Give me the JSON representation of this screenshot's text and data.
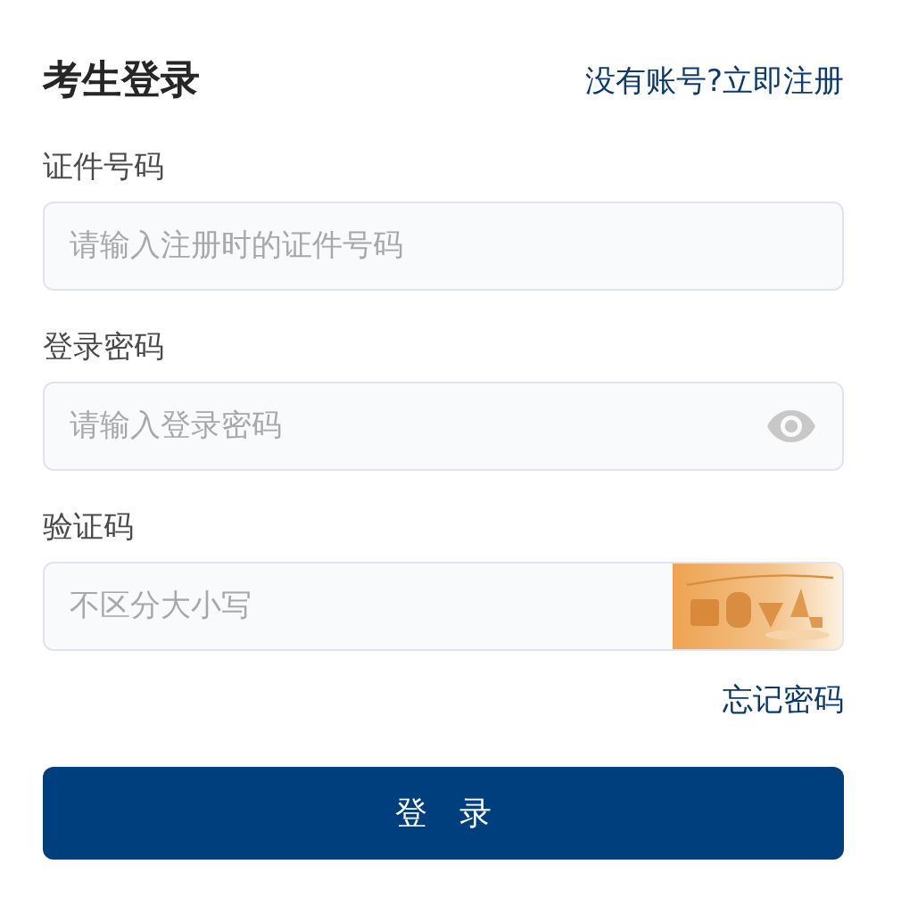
{
  "title": "考生登录",
  "register_link": "没有账号?立即注册",
  "fields": [
    {
      "label": "证件号码",
      "placeholder": "请输入注册时的证件号码",
      "kind": "text"
    },
    {
      "label": "登录密码",
      "placeholder": "请输入登录密码",
      "kind": "password"
    },
    {
      "label": "验证码",
      "placeholder": "不区分大小写",
      "kind": "captcha"
    }
  ],
  "forgot_link": "忘记密码",
  "submit_button": "登 录"
}
